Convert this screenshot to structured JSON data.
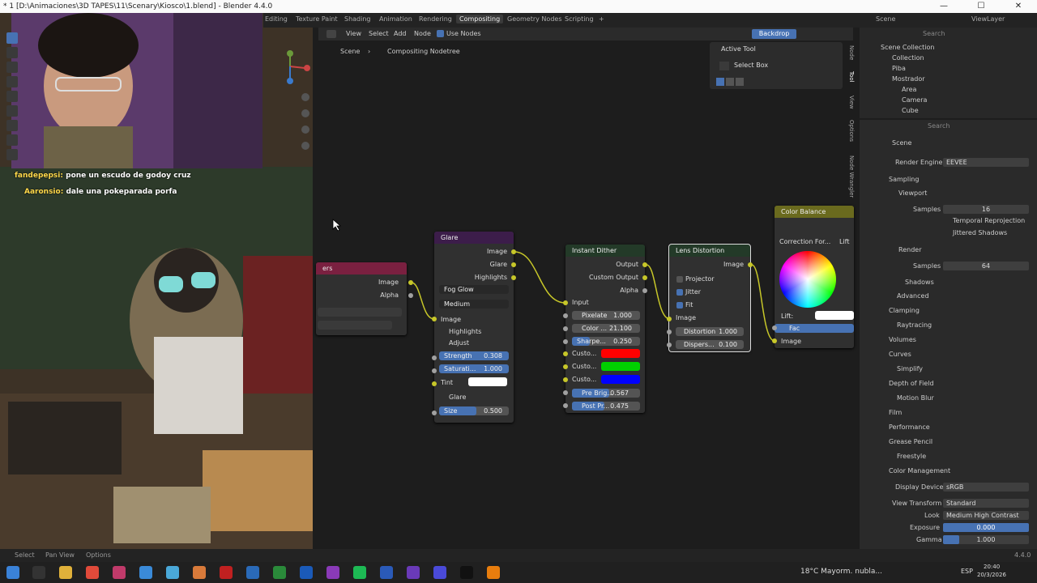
{
  "window": {
    "title": "* 1 [D:\\Animaciones\\3D TAPES\\11\\Scenary\\Kiosco\\1.blend] - Blender 4.4.0",
    "minimize": "—",
    "maximize": "☐",
    "close": "✕"
  },
  "workspaces": {
    "editing": "Editing",
    "texture_paint": "Texture Paint",
    "shading": "Shading",
    "animation": "Animation",
    "rendering": "Rendering",
    "compositing": "Compositing",
    "geometry_nodes": "Geometry Nodes",
    "scripting": "Scripting",
    "add": "+",
    "scene": "Scene",
    "view_layer": "ViewLayer"
  },
  "node_header": {
    "view": "View",
    "select": "Select",
    "add": "Add",
    "node": "Node",
    "use_nodes": "Use Nodes",
    "backdrop": "Backdrop"
  },
  "breadcrumb": {
    "scene": "Scene",
    "sep": "›",
    "tree": "Compositing Nodetree"
  },
  "active_tool": {
    "title": "Active Tool",
    "tool": "Select Box"
  },
  "side_tabs": [
    "Node",
    "Tool",
    "View",
    "Options",
    "Node Wrangler"
  ],
  "nodes": {
    "partial": {
      "title": "ers",
      "image": "Image",
      "alpha": "Alpha"
    },
    "glare": {
      "title": "Glare",
      "out_image": "Image",
      "out_glare": "Glare",
      "out_highlights": "Highlights",
      "type": "Fog Glow",
      "quality": "Medium",
      "in_image": "Image",
      "highlights": "Highlights",
      "adjust": "Adjust",
      "strength_label": "Strength",
      "strength": "0.308",
      "saturation_label": "Saturati...",
      "saturation": "1.000",
      "tint": "Tint",
      "glare_section": "Glare",
      "size_label": "Size",
      "size": "0.500"
    },
    "dither": {
      "title": "Instant Dither",
      "output": "Output",
      "custom_output": "Custom Output",
      "alpha": "Alpha",
      "input": "Input",
      "pixelate_label": "Pixelate",
      "pixelate": "1.000",
      "color_label": "Color ...",
      "color": "21.100",
      "sharpen_label": "Sharpe...",
      "sharpen": "0.250",
      "custom1": "Custo...",
      "custom2": "Custo...",
      "custom3": "Custo...",
      "prebright_label": "Pre Brig...",
      "prebright": "0.567",
      "postpr_label": "Post Pr...",
      "postpr": "0.475",
      "color_red": "#ff0000",
      "color_green": "#00d000",
      "color_blue": "#0000ff"
    },
    "lens": {
      "title": "Lens Distortion",
      "image_out": "Image",
      "projector": "Projector",
      "jitter": "Jitter",
      "fit": "Fit",
      "image_in": "Image",
      "distortion_label": "Distortion",
      "distortion": "1.000",
      "dispersion_label": "Dispers...",
      "dispersion": "0.100"
    },
    "color_balance": {
      "title": "Color Balance",
      "correction": "Correction For...",
      "lift_short": "Lift",
      "lift": "Lift:",
      "fac": "Fac",
      "image": "Image"
    }
  },
  "outliner": {
    "search": "Search",
    "scene_collection": "Scene Collection",
    "items": [
      {
        "label": "Collection"
      },
      {
        "label": "Piba"
      },
      {
        "label": "Mostrador"
      },
      {
        "label": "Area"
      },
      {
        "label": "Camera"
      },
      {
        "label": "Cube"
      }
    ]
  },
  "properties": {
    "search": "Search",
    "scene": "Scene",
    "render_engine_label": "Render Engine",
    "render_engine": "EEVEE",
    "sampling": "Sampling",
    "viewport": "Viewport",
    "samples_label": "Samples",
    "viewport_samples": "16",
    "temporal": "Temporal Reprojection",
    "jittered": "Jittered Shadows",
    "render": "Render",
    "render_samples": "64",
    "shadows": "Shadows",
    "advanced": "Advanced",
    "clamping": "Clamping",
    "raytracing": "Raytracing",
    "volumes": "Volumes",
    "curves": "Curves",
    "simplify": "Simplify",
    "dof": "Depth of Field",
    "motion_blur": "Motion Blur",
    "film": "Film",
    "performance": "Performance",
    "grease_pencil": "Grease Pencil",
    "freestyle": "Freestyle",
    "color_management": "Color Management",
    "display_device_label": "Display Device",
    "display_device": "sRGB",
    "view_transform_label": "View Transform",
    "view_transform": "Standard",
    "look_label": "Look",
    "look": "Medium High Contrast",
    "exposure_label": "Exposure",
    "exposure": "0.000",
    "gamma_label": "Gamma",
    "gamma": "1.000"
  },
  "statusbar": {
    "select": "Select",
    "pan_view": "Pan View",
    "options": "Options",
    "version": "4.4.0"
  },
  "chat": [
    {
      "user": "fandepepsi:",
      "msg": "pone un escudo de godoy cruz"
    },
    {
      "user": "Aaronsio:",
      "msg": "dale una pokeparada porfa"
    }
  ],
  "taskbar": {
    "weather": "18°C  Mayorm. nubla...",
    "lang": "ESP",
    "time": "20:40",
    "date": "20/3/2026"
  },
  "colors": {
    "accent": "#4772b3",
    "image_socket": "#c7c729",
    "value_socket": "#a1a1a1",
    "glare_header": "#3c1d4a",
    "dither_header": "#233a28",
    "color_balance_header": "#6a6a1e",
    "partial_header": "#7a2040"
  }
}
